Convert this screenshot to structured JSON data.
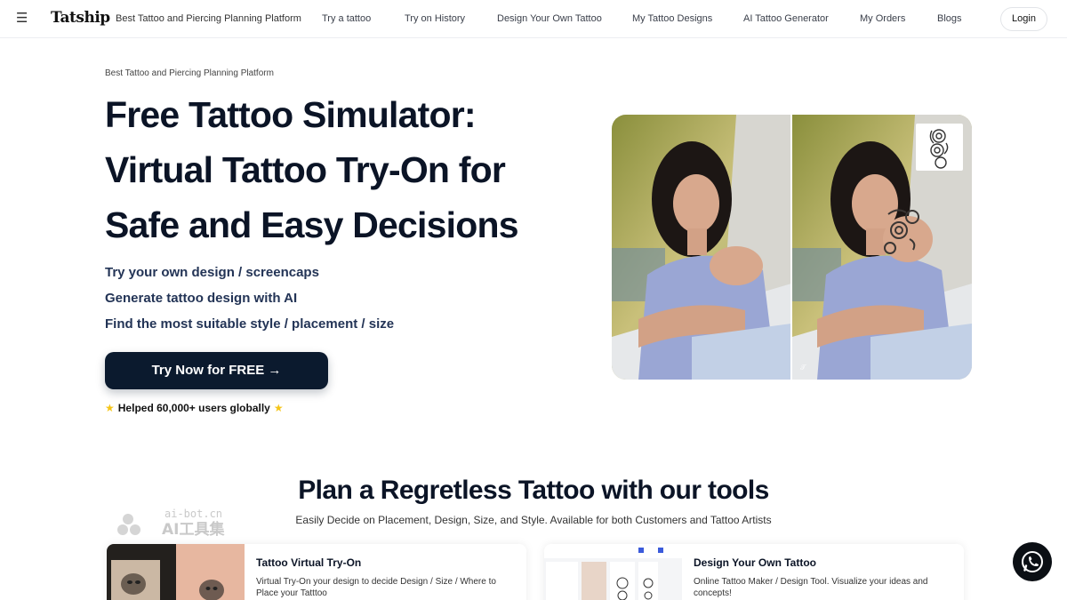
{
  "nav": {
    "logo": "Tatship",
    "tagline": "Best Tattoo and Piercing Planning Platform",
    "links": [
      "Try a tattoo",
      "Try on History",
      "Design Your Own Tattoo",
      "My Tattoo Designs",
      "AI Tattoo Generator",
      "My Orders",
      "Blogs"
    ],
    "login": "Login"
  },
  "hero": {
    "eyebrow": "Best Tattoo and Piercing Planning Platform",
    "title": "Free Tattoo Simulator: Virtual Tattoo Try-On for Safe and Easy Decisions",
    "bullets": [
      "Try your own design / screencaps",
      "Generate tattoo design with AI",
      "Find the most suitable style / placement / size"
    ],
    "cta": "Try Now for FREE →",
    "helped": "Helped 60,000+ users globally"
  },
  "section": {
    "title": "Plan a Regretless Tattoo with our tools",
    "subtitle": "Easily Decide on Placement, Design, Size, and Style. Available for both Customers and Tattoo Artists",
    "site_mark_top": "ai-bot.cn",
    "site_mark_bottom": "AI工具集",
    "cards": [
      {
        "title": "Tattoo Virtual Try-On",
        "desc": "Virtual Try-On your design to decide Design / Size / Where to Place your Tatttoo"
      },
      {
        "title": "Design Your Own Tattoo",
        "desc": "Online Tattoo Maker / Design Tool. Visualize your ideas and concepts!"
      }
    ]
  },
  "icons": {
    "menu": "menu-icon",
    "arrow": "arrow-right-icon",
    "star": "star-icon",
    "whatsapp": "whatsapp-icon"
  },
  "colors": {
    "primary": "#0b1a2e",
    "bullet_text": "#233456",
    "star": "#f5c518"
  }
}
